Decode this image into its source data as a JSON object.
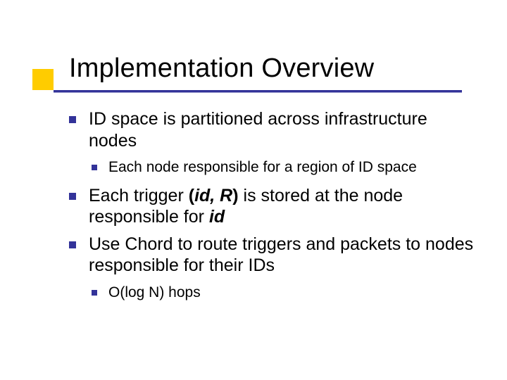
{
  "title": "Implementation Overview",
  "bullets": {
    "b1": "ID space is partitioned across infrastructure nodes",
    "b1_1": "Each node responsible for a region of ID space",
    "b2_pre": "Each trigger ",
    "b2_paren_open": "(",
    "b2_id": "id, R",
    "b2_paren_close": ")",
    "b2_mid": " is stored at the node responsible for ",
    "b2_id2": "id",
    "b3": "Use Chord to route triggers and packets to nodes responsible for their IDs",
    "b3_1": "O(log N) hops"
  }
}
